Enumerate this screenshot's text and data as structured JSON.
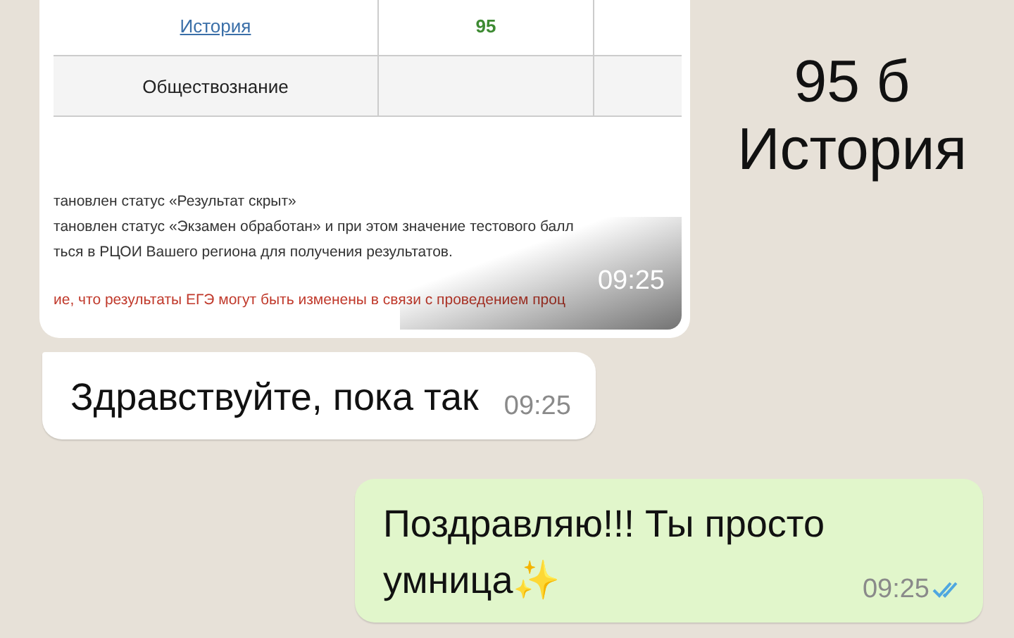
{
  "image_message": {
    "table_rows": [
      {
        "subject": "История",
        "score": "95",
        "link": true
      },
      {
        "subject": "Обществознание",
        "link": false
      }
    ],
    "notes": [
      {
        "text": "тановлен статус «Результат скрыт»",
        "kind": "plain"
      },
      {
        "text": "тановлен статус «Экзамен обработан» и при этом значение тестового балл",
        "kind": "plain"
      },
      {
        "text": "ться в РЦОИ Вашего региона для получения результатов.",
        "kind": "plain"
      },
      {
        "text": "ие, что результаты ЕГЭ могут быть изменены в связи с проведением проц",
        "kind": "warning"
      }
    ],
    "time": "09:25"
  },
  "caption": [
    "95 б",
    "История"
  ],
  "messages": [
    {
      "kind": "incoming",
      "text": "Здравствуйте, пока так",
      "time": "09:25"
    },
    {
      "kind": "outgoing",
      "text": "Поздравляю!!! Ты просто умница✨",
      "time": "09:25",
      "read": true
    }
  ]
}
